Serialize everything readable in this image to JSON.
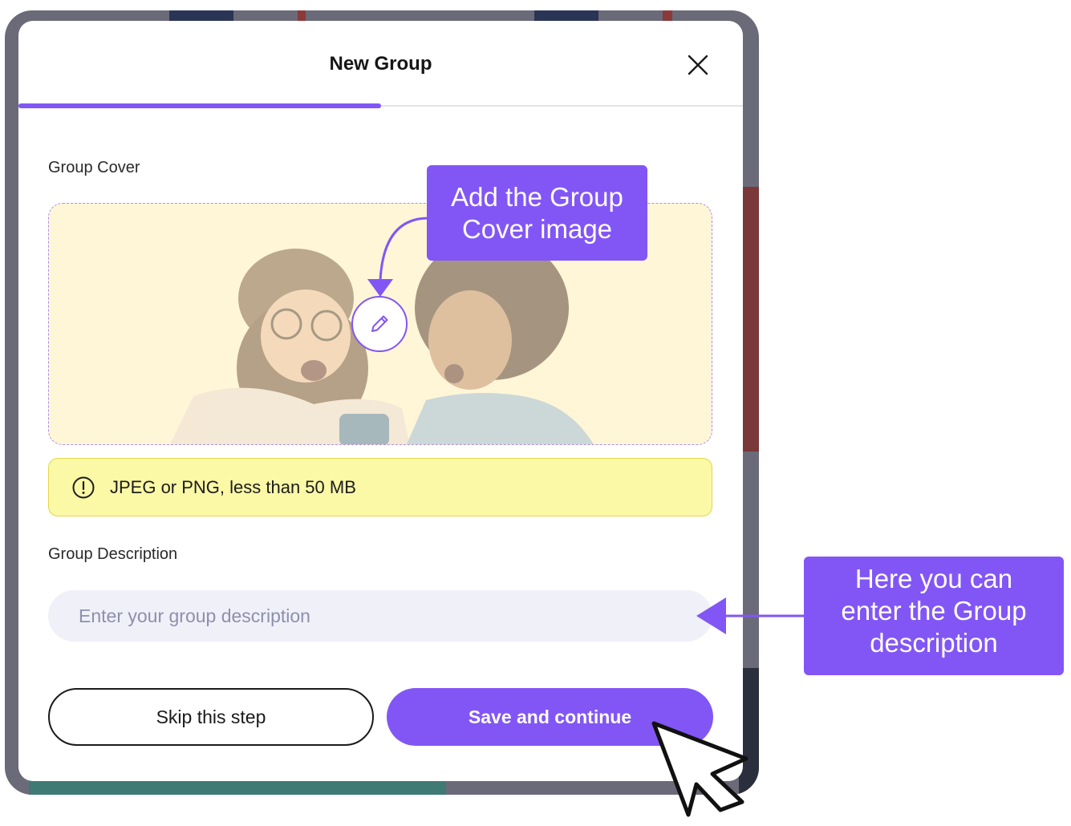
{
  "modal": {
    "title": "New Group",
    "close_icon": "close-icon",
    "progress_fraction": 0.5
  },
  "cover": {
    "label": "Group Cover",
    "edit_icon": "pencil-icon"
  },
  "notice": {
    "icon": "info-circle-icon",
    "text": "JPEG or PNG, less than 50 MB"
  },
  "description": {
    "label": "Group Description",
    "placeholder": "Enter your group description",
    "value": ""
  },
  "buttons": {
    "skip": "Skip this step",
    "save": "Save and continue"
  },
  "annotations": {
    "cover_callout": [
      "Add the Group",
      "Cover image"
    ],
    "description_callout": [
      "Here you can",
      "enter the Group",
      "description"
    ]
  },
  "colors": {
    "accent": "#8256f5",
    "notice_bg": "#fbf8a6",
    "input_bg": "#f0f0f9"
  }
}
